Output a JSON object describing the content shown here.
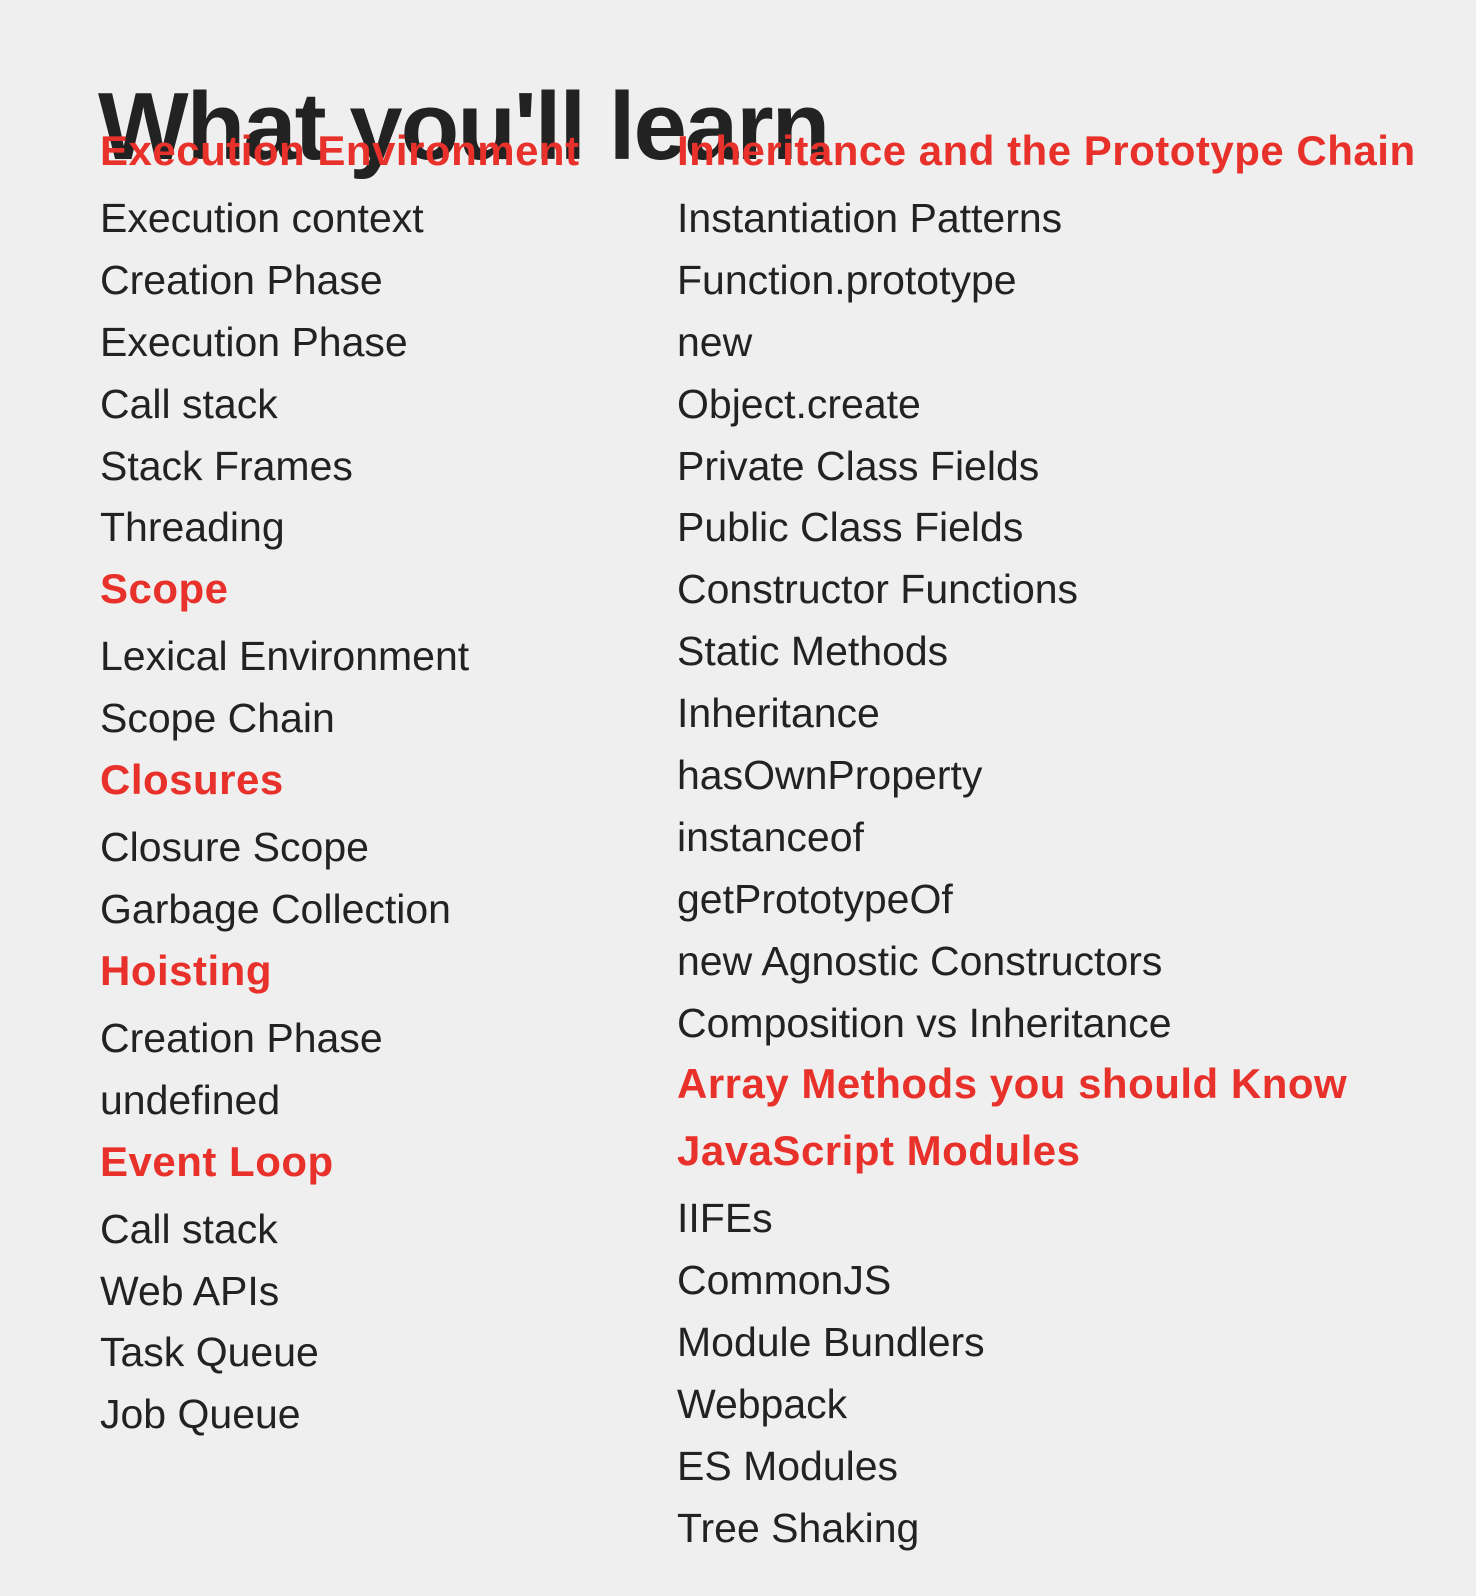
{
  "page": {
    "title": "What you'll learn",
    "accent_color": "#e8312a",
    "text_color": "#222222",
    "background_color": "#efefef"
  },
  "left_column": {
    "sections": [
      {
        "title": "Execution Environment",
        "items": [
          "Execution context",
          "Creation Phase",
          "Execution Phase",
          "Call stack",
          "Stack Frames",
          "Threading"
        ]
      },
      {
        "title": "Scope",
        "items": [
          "Lexical Environment",
          "Scope Chain"
        ]
      },
      {
        "title": "Closures",
        "items": [
          "Closure Scope",
          "Garbage Collection"
        ]
      },
      {
        "title": "Hoisting",
        "items": [
          "Creation Phase",
          "undefined"
        ]
      },
      {
        "title": "Event Loop",
        "items": [
          "Call stack",
          "Web APIs",
          "Task Queue",
          "Job Queue"
        ]
      }
    ]
  },
  "right_column": {
    "sections": [
      {
        "title": "Inheritance and the Prototype Chain",
        "items": [
          "Instantiation Patterns",
          "Function.prototype",
          "new",
          "Object.create",
          "Private Class Fields",
          "Public Class Fields",
          "Constructor Functions",
          "Static Methods",
          "Inheritance",
          "hasOwnProperty",
          "instanceof",
          "getPrototypeOf",
          "new Agnostic Constructors",
          "Composition vs Inheritance"
        ]
      },
      {
        "title": "Array Methods you should Know",
        "items": []
      },
      {
        "title": "JavaScript Modules",
        "items": [
          "IIFEs",
          "CommonJS",
          "Module Bundlers",
          "Webpack",
          "ES Modules",
          "Tree Shaking"
        ]
      }
    ]
  }
}
